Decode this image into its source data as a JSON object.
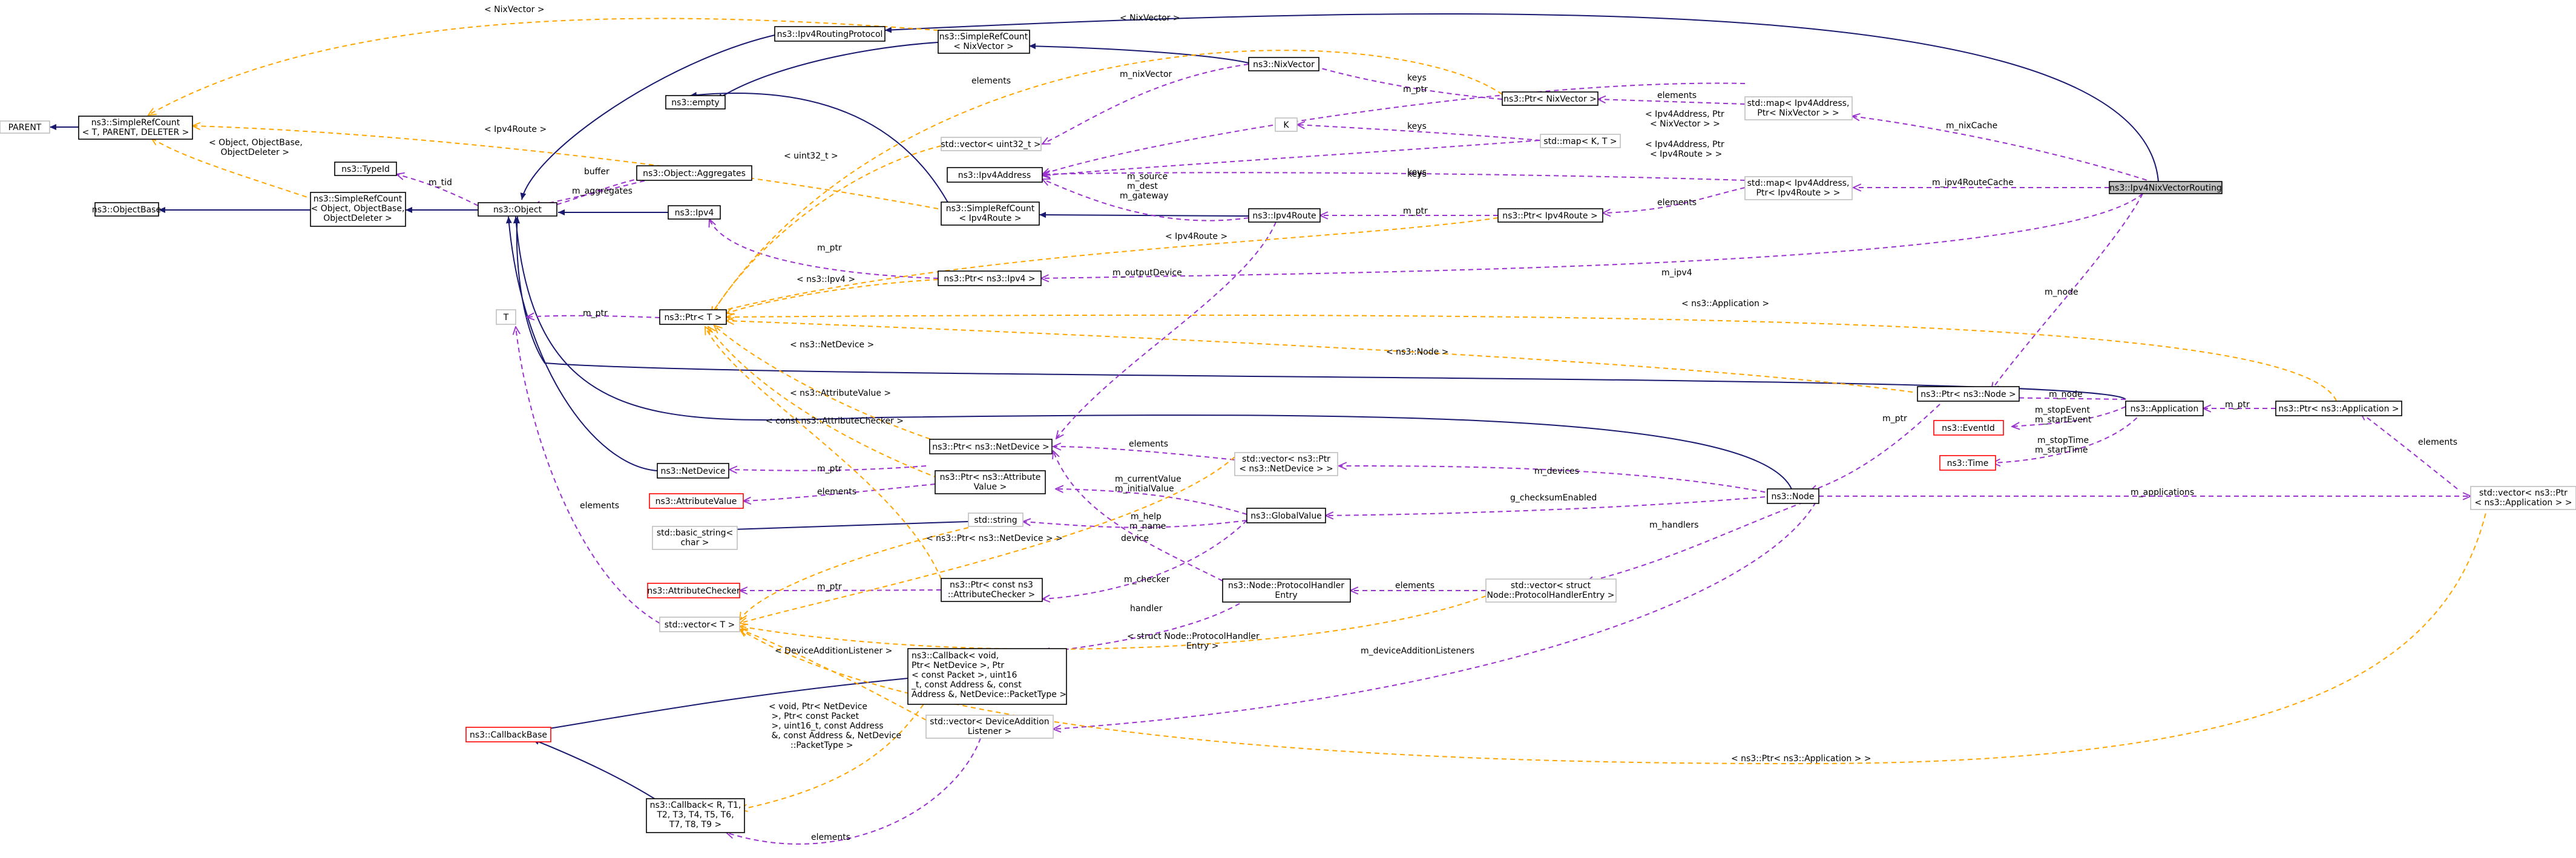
{
  "nodes": {
    "ipv4NixVectorRouting": "ns3::Ipv4NixVectorRouting",
    "ipv4RoutingProtocol": "ns3::Ipv4RoutingProtocol",
    "simpleRefCountNix": [
      "ns3::SimpleRefCount",
      "< NixVector >"
    ],
    "nixVector": "ns3::NixVector",
    "ptrNixVector": "ns3::Ptr< NixVector >",
    "mapNix": [
      "std::map< Ipv4Address,",
      "Ptr< NixVector > >"
    ],
    "empty": "ns3::empty",
    "vecUint32": "std::vector< uint32_t >",
    "K": "K",
    "mapKT": "std::map< K, T >",
    "parent": "PARENT",
    "simpleRefCountT": [
      "ns3::SimpleRefCount",
      "< T, PARENT, DELETER >"
    ],
    "ipv4Address": "ns3::Ipv4Address",
    "mapRoute": [
      "std::map< Ipv4Address,",
      "Ptr< Ipv4Route > >"
    ],
    "typeId": "ns3::TypeId",
    "objectAggregates": "ns3::Object::Aggregates",
    "objectBase": "ns3::ObjectBase",
    "simpleRefCountObj": [
      "ns3::SimpleRefCount",
      "< Object, ObjectBase,",
      "ObjectDeleter >"
    ],
    "object": "ns3::Object",
    "simpleRefCountRoute": [
      "ns3::SimpleRefCount",
      "< Ipv4Route >"
    ],
    "ipv4Route": "ns3::Ipv4Route",
    "ptrIpv4Route": "ns3::Ptr< Ipv4Route >",
    "ipv4": "ns3::Ipv4",
    "ptrIpv4": "ns3::Ptr< ns3::Ipv4 >",
    "T": "T",
    "ptrT": "ns3::Ptr< T >",
    "ptrNode": "ns3::Ptr< ns3::Node >",
    "application": "ns3::Application",
    "ptrApplication": "ns3::Ptr< ns3::Application >",
    "netDevice": "ns3::NetDevice",
    "ptrNetDevice": "ns3::Ptr< ns3::NetDevice >",
    "vecPtrNetDevice": [
      "std::vector< ns3::Ptr",
      "< ns3::NetDevice > >"
    ],
    "eventId": "ns3::EventId",
    "time": "ns3::Time",
    "attributeValue": "ns3::AttributeValue",
    "ptrAttrValue": [
      "ns3::Ptr< ns3::Attribute",
      "Value >"
    ],
    "node": "ns3::Node",
    "globalValue": "ns3::GlobalValue",
    "vecPtrApplication": [
      "std::vector< ns3::Ptr",
      "< ns3::Application > >"
    ],
    "string": "std::string",
    "basicString": [
      "std::basic_string<",
      "char >"
    ],
    "attributeChecker": "ns3::AttributeChecker",
    "ptrAttrChecker": [
      "ns3::Ptr< const ns3",
      "::AttributeChecker >"
    ],
    "protocolHandlerEntry": [
      "ns3::Node::ProtocolHandler",
      "Entry"
    ],
    "vecProtocolHandler": [
      "std::vector< struct",
      "Node::ProtocolHandlerEntry >"
    ],
    "vectorT": "std::vector< T >",
    "callbackSig": [
      "ns3::Callback< void,",
      " Ptr< NetDevice >, Ptr",
      "< const Packet >, uint16",
      "_t, const Address &, const",
      " Address &, NetDevice::PacketType >"
    ],
    "callbackBase": "ns3::CallbackBase",
    "vecDeviceListener": [
      "std::vector< DeviceAddition",
      "Listener >"
    ],
    "callbackR": [
      "ns3::Callback< R, T1,",
      " T2, T3, T4, T5, T6,",
      " T7, T8, T9 >"
    ]
  },
  "edge_labels": {
    "nixVectorTop": "< NixVector >",
    "nixVectorMid": "< NixVector >",
    "elementsTop": "elements",
    "mNixVector": "m_nixVector",
    "keys1": "keys",
    "mPtr1": "m_ptr",
    "elements2": "elements",
    "keys2": "keys",
    "keys3": "keys",
    "mapKTNix": [
      "< Ipv4Address, Ptr",
      "< NixVector > >"
    ],
    "mapKTRoute": [
      "< Ipv4Address, Ptr",
      "< Ipv4Route > >"
    ],
    "mNixCache": "m_nixCache",
    "mIpv4RouteCache": "m_ipv4RouteCache",
    "ipv4RouteTpl1": "< Ipv4Route >",
    "objectTpl": [
      "< Object, ObjectBase,",
      " ObjectDeleter >"
    ],
    "uint32Tpl": "< uint32_t >",
    "buffer": "buffer",
    "mAggregates": "m_aggregates",
    "mTid": "m_tid",
    "mSourceDest": [
      "m_source",
      "m_dest",
      "m_gateway"
    ],
    "keys4": "keys",
    "mPtr2": "m_ptr",
    "elements3": "elements",
    "ipv4RouteTpl2": "< Ipv4Route >",
    "mPtr3": "m_ptr",
    "mOutputDevice": "m_outputDevice",
    "mIpv4": "m_ipv4",
    "ipv4Tpl": "< ns3::Ipv4 >",
    "mPtrT": "m_ptr",
    "applicationTpl": "< ns3::Application >",
    "mNode": "m_node",
    "netDeviceTpl": "< ns3::NetDevice >",
    "nodeTpl": "< ns3::Node >",
    "mNode2": "m_node",
    "mPtr4": "m_ptr",
    "attrValueTpl": "< ns3::AttributeValue >",
    "attrCheckerTpl": "< const ns3::AttributeChecker >",
    "elements4": "elements",
    "mDevices": "m_devices",
    "mStopEvent": [
      "m_stopEvent",
      "m_startEvent"
    ],
    "mStopTime": [
      "m_stopTime",
      "m_startTime"
    ],
    "mPtr5": "m_ptr",
    "elements5": "elements",
    "mApplications": "m_applications",
    "mPtr6": "m_ptr",
    "mCurrentValue": [
      "m_currentValue",
      "m_initialValue"
    ],
    "gChecksum": "g_checksumEnabled",
    "elements6": "elements",
    "mHelp": [
      "m_help",
      "m_name"
    ],
    "netDeviceVecTpl": "< ns3::Ptr< ns3::NetDevice > >",
    "mHandlers": "m_handlers",
    "mPtr7": "m_ptr",
    "device": "device",
    "mChecker": "m_checker",
    "elements7": "elements",
    "handler": "handler",
    "protocolHandlerTpl": [
      "< struct Node::ProtocolHandler",
      "Entry >"
    ],
    "deviceListenerTpl": "< DeviceAdditionListener >",
    "mDeviceAddition": "m_deviceAdditionListeners",
    "callbackTpl": [
      "< void, Ptr< NetDevice",
      " >, Ptr< const Packet",
      " >, uint16_t, const Address",
      " &, const Address &, NetDevice",
      "::PacketType >"
    ],
    "appVecTpl": "< ns3::Ptr< ns3::Application > >",
    "elements8": "elements"
  },
  "colors": {
    "inheritance": "#191970",
    "usage": "#9a32cd",
    "template": "#ffa500",
    "highlight_fill": "#bfbfbf",
    "undocumented_border": "#bfbfbf",
    "no_doc_border": "#ff0000"
  }
}
